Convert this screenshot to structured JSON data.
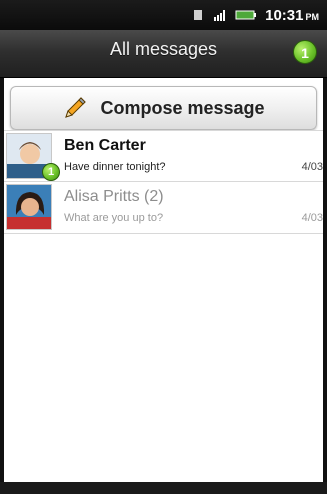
{
  "status_bar": {
    "time": "10:31",
    "time_suffix": "PM"
  },
  "title_bar": {
    "title": "All messages",
    "notification_count": "1"
  },
  "compose": {
    "label": "Compose message"
  },
  "conversations": [
    {
      "name": "Ben Carter",
      "preview": "Have dinner tonight?",
      "date": "4/03",
      "unread_badge": "1"
    },
    {
      "name": "Alisa Pritts (2)",
      "preview": "What are you up to?",
      "date": "4/03"
    }
  ],
  "colors": {
    "accent_green": "#6cc22a",
    "title_bg": "#2f2f2f",
    "read_text": "#9a9a9a"
  }
}
